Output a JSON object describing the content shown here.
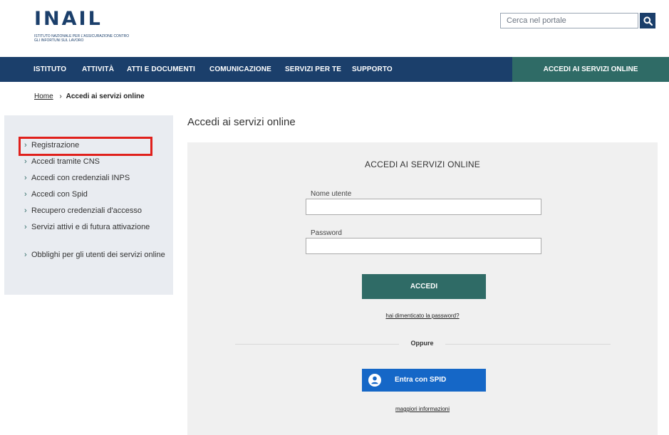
{
  "header": {
    "logo_text": "INAIL",
    "logo_subtitle": "ISTITUTO NAZIONALE PER L'ASSICURAZIONE CONTRO GLI INFORTUNI SUL LAVORO",
    "search_placeholder": "Cerca nel portale",
    "search_icon": "search-icon"
  },
  "nav": {
    "items": [
      "ISTITUTO",
      "ATTIVITÀ",
      "ATTI E DOCUMENTI",
      "COMUNICAZIONE",
      "SERVIZI PER TE",
      "SUPPORTO"
    ],
    "cta": "ACCEDI AI SERVIZI ONLINE"
  },
  "breadcrumb": {
    "home": "Home",
    "separator": "›",
    "current": "Accedi ai servizi online"
  },
  "sidebar": {
    "chevron": "›",
    "items": [
      "Registrazione",
      "Accedi tramite CNS",
      "Accedi con credenziali INPS",
      "Accedi con Spid",
      "Recupero credenziali d'accesso",
      "Servizi attivi e di futura attivazione",
      "Obblighi per gli utenti dei servizi online"
    ]
  },
  "main": {
    "title": "Accedi ai servizi online",
    "panel_title": "ACCEDI AI SERVIZI ONLINE",
    "username_label": "Nome utente",
    "username_value": "",
    "password_label": "Password",
    "password_value": "",
    "login_button": "ACCEDI",
    "forgot_link": "hai dimenticato la password?",
    "divider_text": "Oppure",
    "spid_button": "Entra con SPID",
    "spid_icon": "user-icon",
    "more_info_link": "maggiori informazioni"
  },
  "colors": {
    "nav_bg": "#1b3f6b",
    "accent_green": "#2f6b66",
    "spid_blue": "#1567c7",
    "highlight_red": "#e0201c",
    "sidebar_bg": "#e9ecf1",
    "panel_bg": "#f0f0f0"
  }
}
